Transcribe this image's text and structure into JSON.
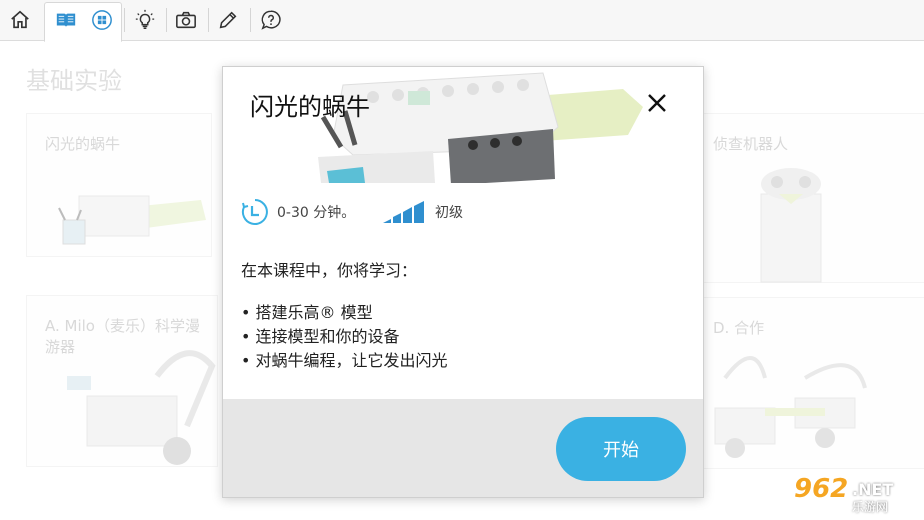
{
  "toolbar": {
    "icons": [
      "home-icon",
      "book-icon",
      "grid-icon",
      "lightbulb-icon",
      "camera-icon",
      "pencil-icon",
      "help-icon"
    ]
  },
  "page": {
    "title": "基础实验",
    "cards": [
      {
        "label": "闪光的蜗牛"
      },
      {
        "label": "侦查机器人"
      },
      {
        "label": "A. Milo（麦乐）科学漫\n游器"
      },
      {
        "label": "D. 合作"
      }
    ]
  },
  "modal": {
    "title": "闪光的蜗牛",
    "duration": "0-30 分钟。",
    "level": "初级",
    "intro": "在本课程中，你将学习：",
    "bullets": [
      "• 搭建乐高® 模型",
      "• 连接模型和你的设备",
      "• 对蜗牛编程，让它发出闪光"
    ],
    "start_label": "开始"
  },
  "watermark": {
    "number": "962",
    "net": ".NET",
    "sub": "乐游网"
  },
  "colors": {
    "accent": "#3ab1e3",
    "footer": "#e6e6e6"
  }
}
